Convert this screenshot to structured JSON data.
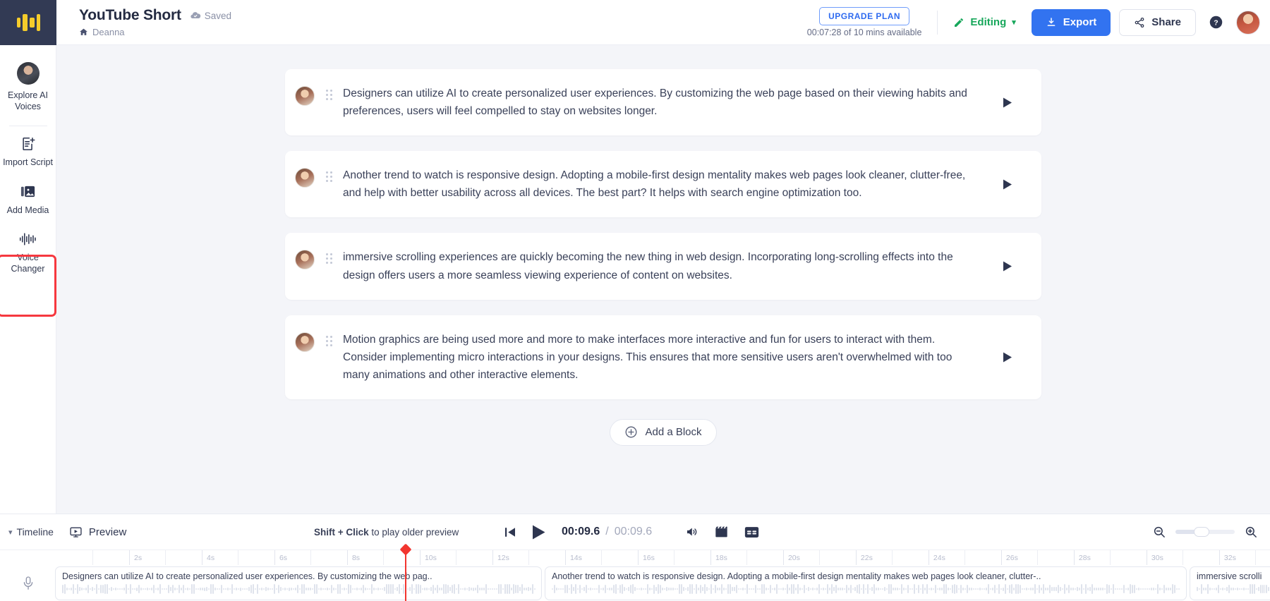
{
  "app": {
    "logo_name": "speechify-logo",
    "accent_blue": "#3273f0",
    "accent_green": "#17a75b",
    "accent_red": "#f6383f",
    "logo_yellow": "#f5cc2b",
    "sidebar_bg": "#323a54"
  },
  "header": {
    "doc_title": "YouTube Short",
    "saved_label": "Saved",
    "breadcrumb_home": "Deanna",
    "upgrade_label": "UPGRADE PLAN",
    "plan_usage": "00:07:28 of 10 mins available",
    "editing_label": "Editing",
    "export_label": "Export",
    "share_label": "Share"
  },
  "sidebar": {
    "items": [
      {
        "label": "Explore AI Voices",
        "icon": "avatar-icon",
        "name": "explore-ai-voices",
        "highlighted": false
      },
      {
        "label": "Import Script",
        "icon": "import-script-icon",
        "name": "import-script",
        "highlighted": false
      },
      {
        "label": "Add Media",
        "icon": "add-media-icon",
        "name": "add-media",
        "highlighted": false
      },
      {
        "label": "Voice Changer",
        "icon": "voice-changer-icon",
        "name": "voice-changer",
        "highlighted": true
      }
    ]
  },
  "main": {
    "blocks": [
      {
        "text": "Designers can utilize AI to create personalized user experiences. By customizing the web page based on their viewing habits and preferences, users will feel compelled to stay on websites longer."
      },
      {
        "text": "Another trend to watch is responsive design. Adopting a mobile-first design mentality makes web pages look cleaner, clutter-free, and help with better usability across all devices. The best part? It helps with search engine optimization too."
      },
      {
        "text": "immersive scrolling experiences are quickly becoming the new thing in web design. Incorporating long-scrolling effects into the design offers users a more seamless viewing experience of content on websites."
      },
      {
        "text": "Motion graphics are being used more and more to make interfaces more interactive and fun for users to interact with them. Consider implementing micro interactions in your designs. This ensures that more sensitive users aren't overwhelmed with too many animations and other interactive elements."
      }
    ],
    "add_block_label": "Add a Block"
  },
  "bottom": {
    "timeline_label": "Timeline",
    "preview_label": "Preview",
    "shift_hint_bold": "Shift + Click",
    "shift_hint_rest": " to play older preview",
    "current_time": "00:09.6",
    "total_time": "00:09.6",
    "time_separator": "/",
    "ruler_ticks": [
      "2s",
      "4s",
      "6s",
      "8s",
      "10s",
      "12s",
      "14s",
      "16s",
      "18s",
      "20s",
      "22s",
      "24s",
      "26s",
      "28s",
      "30s",
      "32s"
    ],
    "playhead_time_s": 9.6,
    "clips": [
      {
        "label": "Designers can utilize AI to create personalized user experiences. By customizing the web pag.."
      },
      {
        "label": "Another trend to watch is responsive design. Adopting a mobile-first design mentality makes web pages look cleaner, clutter-.."
      },
      {
        "label": "immersive scrolli"
      }
    ]
  }
}
